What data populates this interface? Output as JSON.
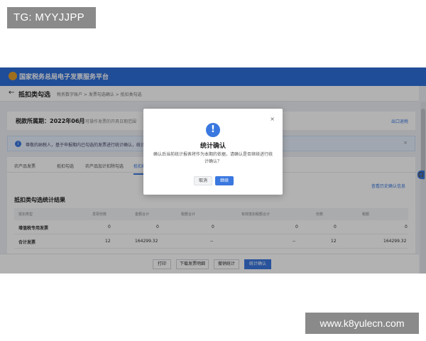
{
  "watermarks": {
    "top_left": "TG: MYYJJPP",
    "bottom_right": "www.k8yulecn.com"
  },
  "app": {
    "brand": "国家税务总局电子发票服务平台"
  },
  "page": {
    "back_glyph": "←",
    "title": "抵扣类勾选",
    "breadcrumb": "税务数字账户 > 发票勾选确认 > 抵扣类勾选"
  },
  "period": {
    "label": "税款所属期：2022年06月",
    "desc": "当前可操作发票的开具日期范围",
    "link": "出口退税"
  },
  "notice": {
    "icon": "i",
    "text": "尊敬的纳税人，基于申报期内已勾选的发票进行统计确认，统计确认后可进行申报，如需继续勾选请撤销统计后再进行发票勾选操作。",
    "close": "×"
  },
  "tabs": [
    {
      "label": "农产品发票"
    },
    {
      "label": "抵扣勾选"
    },
    {
      "label": "农产品加计扣除勾选"
    },
    {
      "label": "抵扣统计"
    }
  ],
  "tab_link": "查看历史确认信息",
  "section_title": "抵扣类勾选统计结果",
  "table": {
    "headers": [
      "抵扣类型",
      "发票份数",
      "金额合计",
      "税额合计",
      "有效抵扣税额合计",
      "份数",
      "税额"
    ],
    "rows": [
      {
        "cells": [
          "增值税专用发票",
          "0",
          "0",
          "0",
          "0",
          "0",
          "0"
        ]
      },
      {
        "cells": [
          "合计发票",
          "12",
          "164299.32",
          "--",
          "--",
          "12",
          "164299.32"
        ]
      }
    ]
  },
  "footer_buttons": {
    "print": "打印",
    "download": "下载发票明细",
    "cancel_stat": "撤销统计",
    "confirm_stat": "统计确认"
  },
  "float_icon": "🎧",
  "modal": {
    "close": "×",
    "icon": "!",
    "title": "统计确认",
    "body": "确认后当前统计报表将作为本期的依据，请确认是否继续进行统计确认？",
    "cancel": "取消",
    "ok": "继续"
  },
  "colors": {
    "primary": "#3a78e0",
    "topbar": "#2f6fd8"
  }
}
